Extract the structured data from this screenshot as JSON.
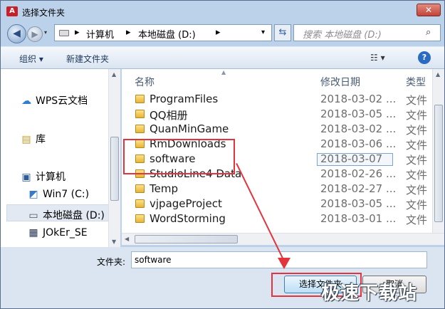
{
  "window": {
    "title": "选择文件夹",
    "close": "✕",
    "app_icon": "A"
  },
  "nav": {
    "back": "◀",
    "forward": "▶",
    "dropdown": "▾",
    "refresh": "⇆",
    "breadcrumbs": [
      "计算机",
      "本地磁盘 (D:)"
    ],
    "separator": "▸",
    "address_drop": "▾",
    "search_placeholder": "搜索 本地磁盘 (D:)",
    "search_icon": "⌕"
  },
  "toolbar": {
    "organize": "组织 ▾",
    "new_folder": "新建文件夹",
    "view": "☷ ▾",
    "help": "?"
  },
  "navpane": {
    "items": [
      {
        "label": "WPS云文档",
        "icon": "cloud-icon",
        "glyph": "☁"
      },
      {
        "label": "库",
        "icon": "library-icon",
        "glyph": "▤"
      },
      {
        "label": "计算机",
        "icon": "computer-icon",
        "glyph": "▣"
      },
      {
        "label": "Win7 (C:)",
        "icon": "windows-drive-icon",
        "glyph": "◩"
      },
      {
        "label": "本地磁盘 (D:)",
        "icon": "drive-icon",
        "glyph": "▭"
      },
      {
        "label": "JOkEr_SE",
        "icon": "network-drive-icon",
        "glyph": "▦"
      }
    ]
  },
  "files": {
    "headers": {
      "name": "名称",
      "date": "修改日期",
      "type": "类型"
    },
    "sort_arrow": "▲",
    "rows": [
      {
        "name": "ProgramFiles",
        "date": "2018-03-02 ...",
        "type": "文件"
      },
      {
        "name": "QQ相册",
        "date": "2018-03-05 ...",
        "type": "文件"
      },
      {
        "name": "QuanMinGame",
        "date": "2018-03-02 ...",
        "type": "文件"
      },
      {
        "name": "RmDownloads",
        "date": "2018-03-06 ...",
        "type": "文件"
      },
      {
        "name": "software",
        "date": "2018-03-07",
        "type": "文件"
      },
      {
        "name": "StudioLine4 Data",
        "date": "2018-02-26 ...",
        "type": "文件"
      },
      {
        "name": "Temp",
        "date": "2018-02-27 ...",
        "type": "文件"
      },
      {
        "name": "vjpageProject",
        "date": "2018-03-05 ...",
        "type": "文件"
      },
      {
        "name": "WordStorming",
        "date": "2018-03-01 ...",
        "type": "文件"
      }
    ]
  },
  "bottom": {
    "folder_label": "文件夹:",
    "folder_value": "software",
    "select_button": "选择文件夹",
    "cancel_button": "取消"
  },
  "watermark": "极速下载站",
  "colors": {
    "annotation": "#e3343e",
    "chrome": "#bcd1ea",
    "selection": "#f3f7fc"
  }
}
